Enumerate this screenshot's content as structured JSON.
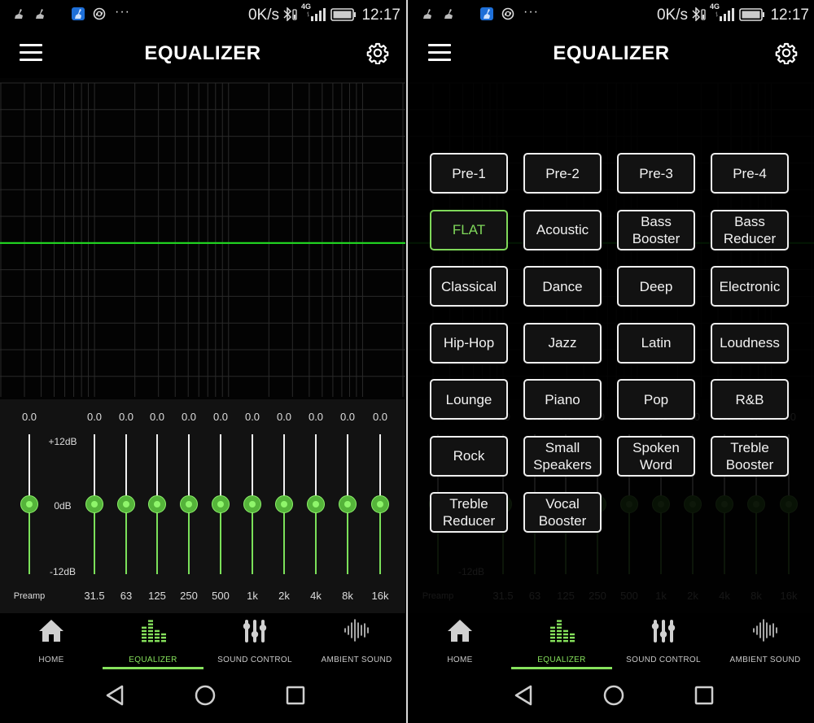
{
  "status_bar": {
    "net_speed": "0K/s",
    "network_type": "4G",
    "time": "12:17",
    "icons": [
      "broom-icon",
      "broom-icon",
      "cleaner-app-icon",
      "sync-icon",
      "more-dots-icon",
      "bluetooth-icon",
      "signal-icon",
      "battery-icon"
    ]
  },
  "header": {
    "title": "EQUALIZER",
    "menu_icon": "hamburger-menu-icon",
    "settings_icon": "gear-icon"
  },
  "graph": {
    "curve_color": "#22dd22",
    "gain_db": 0.0
  },
  "equalizer": {
    "range_max_label": "+12dB",
    "range_mid_label": "0dB",
    "range_min_label": "-12dB",
    "range_db": [
      -12,
      12
    ],
    "accent_color": "#7be05a",
    "preamp": {
      "label": "Preamp",
      "value": "0.0",
      "gain_db": 0
    },
    "bands": [
      {
        "freq": "31.5",
        "value": "0.0",
        "gain_db": 0
      },
      {
        "freq": "63",
        "value": "0.0",
        "gain_db": 0
      },
      {
        "freq": "125",
        "value": "0.0",
        "gain_db": 0
      },
      {
        "freq": "250",
        "value": "0.0",
        "gain_db": 0
      },
      {
        "freq": "500",
        "value": "0.0",
        "gain_db": 0
      },
      {
        "freq": "1k",
        "value": "0.0",
        "gain_db": 0
      },
      {
        "freq": "2k",
        "value": "0.0",
        "gain_db": 0
      },
      {
        "freq": "4k",
        "value": "0.0",
        "gain_db": 0
      },
      {
        "freq": "8k",
        "value": "0.0",
        "gain_db": 0
      },
      {
        "freq": "16k",
        "value": "0.0",
        "gain_db": 0
      }
    ]
  },
  "tabs": [
    {
      "label": "HOME",
      "icon": "home-icon",
      "active": false
    },
    {
      "label": "EQUALIZER",
      "icon": "equalizer-bars-icon",
      "active": true
    },
    {
      "label": "SOUND CONTROL",
      "icon": "mixer-sliders-icon",
      "active": false
    },
    {
      "label": "AMBIENT SOUND",
      "icon": "sound-wave-icon",
      "active": false
    }
  ],
  "nav": {
    "back_icon": "back-triangle-icon",
    "home_icon": "home-circle-icon",
    "recents_icon": "recents-square-icon"
  },
  "presets": {
    "selected": "FLAT",
    "items": [
      {
        "label": "Pre-1"
      },
      {
        "label": "Pre-2"
      },
      {
        "label": "Pre-3"
      },
      {
        "label": "Pre-4"
      },
      {
        "label": "FLAT"
      },
      {
        "label": "Acoustic"
      },
      {
        "label": "Bass Booster"
      },
      {
        "label": "Bass Reducer"
      },
      {
        "label": "Classical"
      },
      {
        "label": "Dance"
      },
      {
        "label": "Deep"
      },
      {
        "label": "Electronic"
      },
      {
        "label": "Hip-Hop"
      },
      {
        "label": "Jazz"
      },
      {
        "label": "Latin"
      },
      {
        "label": "Loudness"
      },
      {
        "label": "Lounge"
      },
      {
        "label": "Piano"
      },
      {
        "label": "Pop"
      },
      {
        "label": "R&B"
      },
      {
        "label": "Rock"
      },
      {
        "label": "Small Speakers"
      },
      {
        "label": "Spoken Word"
      },
      {
        "label": "Treble Booster"
      },
      {
        "label": "Treble Reducer"
      },
      {
        "label": "Vocal Booster"
      }
    ]
  }
}
